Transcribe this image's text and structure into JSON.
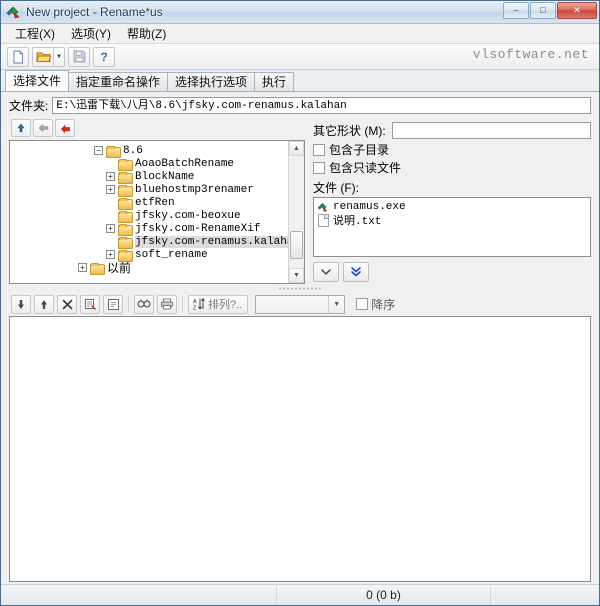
{
  "window": {
    "title": "New project - Rename*us",
    "icon": "app-icon",
    "caption": {
      "minimize": "–",
      "maximize": "□",
      "close": "✕"
    }
  },
  "menubar": {
    "items": [
      {
        "label": "工程(X)",
        "name": "menu-project"
      },
      {
        "label": "选项(Y)",
        "name": "menu-options"
      },
      {
        "label": "帮助(Z)",
        "name": "menu-help"
      }
    ]
  },
  "toolbar": {
    "buttons": [
      {
        "name": "new-project-icon",
        "title": "new"
      },
      {
        "name": "open-project-icon",
        "title": "open"
      },
      {
        "name": "save-project-icon",
        "title": "save"
      },
      {
        "name": "help-icon",
        "title": "help"
      }
    ],
    "dropdown_glyph": "▼",
    "watermark": "vlsoftware.net"
  },
  "tabs": [
    {
      "label": "选择文件",
      "active": true,
      "name": "tab-select-files"
    },
    {
      "label": "指定重命名操作",
      "active": false,
      "name": "tab-rename-actions"
    },
    {
      "label": "选择执行选项",
      "active": false,
      "name": "tab-exec-options"
    },
    {
      "label": "执行",
      "active": false,
      "name": "tab-execute"
    }
  ],
  "path": {
    "label": "文件夹:",
    "value": "E:\\迅雷下载\\八月\\8.6\\jfsky.com-renamus.kalahan",
    "placeholder": ""
  },
  "tree": {
    "nav_buttons": [
      {
        "name": "go-up-button",
        "glyph": "↑"
      },
      {
        "name": "go-back-button",
        "glyph": "←"
      },
      {
        "name": "go-home-button",
        "glyph": "↩"
      }
    ],
    "nodes": [
      {
        "label": "8.6",
        "indent": 0,
        "expander": "−",
        "selected": false
      },
      {
        "label": "AoaoBatchRename",
        "indent": 1,
        "expander": "",
        "selected": false
      },
      {
        "label": "BlockName",
        "indent": 1,
        "expander": "+",
        "selected": false
      },
      {
        "label": "bluehostmp3renamer",
        "indent": 1,
        "expander": "+",
        "selected": false
      },
      {
        "label": "etfRen",
        "indent": 1,
        "expander": "",
        "selected": false
      },
      {
        "label": "jfsky.com-beoxue",
        "indent": 1,
        "expander": "",
        "selected": false
      },
      {
        "label": "jfsky.com-RenameXif",
        "indent": 1,
        "expander": "+",
        "selected": false
      },
      {
        "label": "jfsky.com-renamus.kalahan",
        "indent": 1,
        "expander": "",
        "selected": true
      },
      {
        "label": "soft_rename",
        "indent": 1,
        "expander": "+",
        "selected": false
      },
      {
        "label": "以前",
        "indent": -1,
        "expander": "+",
        "selected": false
      }
    ],
    "scroll": {
      "up": "▲",
      "down": "▼"
    }
  },
  "options": {
    "mask_label": "其它形状 (M):",
    "mask_value": "",
    "mask_placeholder": "",
    "checkboxes": [
      {
        "label": "包含子目录",
        "checked": false,
        "name": "include-subfolders-checkbox"
      },
      {
        "label": "包含只读文件",
        "checked": false,
        "name": "include-readonly-checkbox"
      }
    ],
    "files_label": "文件 (F):",
    "files": [
      {
        "name": "renamus.exe",
        "icon": "app-file-icon"
      },
      {
        "name": "说明.txt",
        "icon": "text-file-icon"
      }
    ],
    "add_buttons": [
      {
        "name": "add-selected-button",
        "glyph": "⌄"
      },
      {
        "name": "add-all-button",
        "glyph": "»"
      }
    ]
  },
  "list_toolbar": {
    "buttons": [
      {
        "name": "move-down-icon",
        "glyph": "↓"
      },
      {
        "name": "move-up-icon",
        "glyph": "↑"
      },
      {
        "name": "remove-icon",
        "glyph": "✕"
      },
      {
        "name": "clear-list-icon",
        "glyph": "▤"
      },
      {
        "name": "edit-list-icon",
        "glyph": "▣"
      },
      {
        "name": "find-icon",
        "glyph": "☎"
      },
      {
        "name": "print-icon",
        "glyph": "⎙"
      }
    ],
    "sort_label": "排列?..",
    "sort_icon": "sort-az-icon",
    "combo_value": "",
    "combo_arrow": "▼",
    "descending_label": "降序",
    "descending_checked": false
  },
  "statusbar": {
    "count_text": "0  (0 b)"
  }
}
